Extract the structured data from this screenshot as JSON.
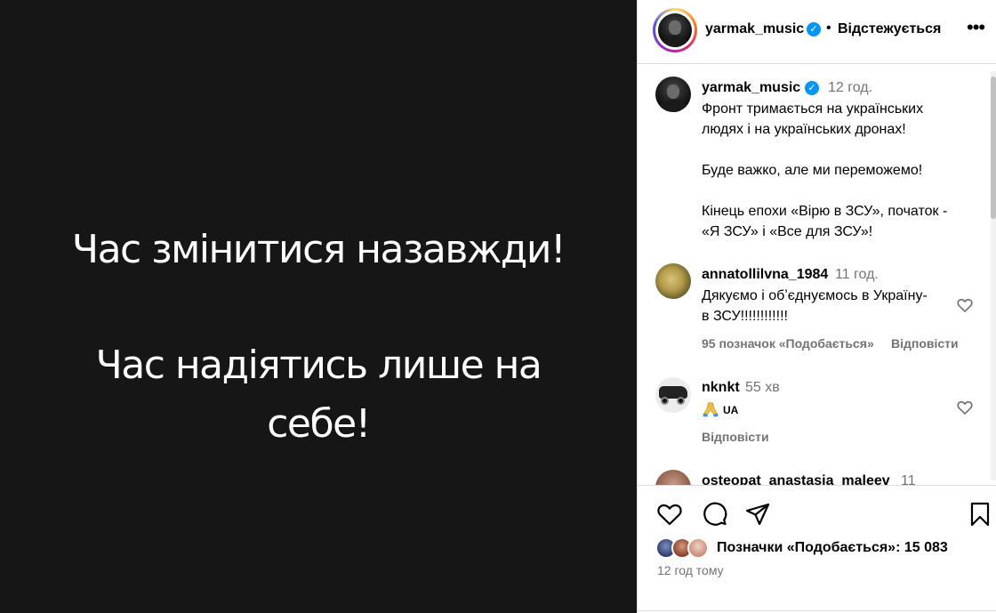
{
  "media": {
    "line1": "Час змінитися назавжди!",
    "line2": "Час надіятись лише на",
    "line3": "себе!",
    "background": "#161616",
    "text_color": "#ffffff"
  },
  "header": {
    "username": "yarmak_music",
    "verified_icon": "verified-badge-icon",
    "separator": "•",
    "follow_status": "Відстежується",
    "more_icon": "more-horizontal-icon"
  },
  "caption": {
    "username": "yarmak_music",
    "time": "12 год.",
    "text": "Фронт тримається на українських\nлюдях і на українських дронах!\n\nБуде важко, але ми переможемо!\n\nКінець епохи «Вірю в ЗСУ», початок -\n«Я ЗСУ» і «Все для ЗСУ»!"
  },
  "comments": [
    {
      "username": "annatollilvna_1984",
      "time": "11 год.",
      "text_line1": "Дякуємо і обʼєднуємось в Україну-",
      "text_line2": "в ЗСУ!!!!!!!!!!!!",
      "likes": "95 позначок «Подобається»",
      "reply": "Відповісти"
    },
    {
      "username": "nknkt",
      "time": "55 хв",
      "emoji": "folded-hands-emoji",
      "text": "UA",
      "reply": "Відповісти"
    },
    {
      "username": "osteopat_anastasia_maleev",
      "time": "11"
    }
  ],
  "actions": {
    "like_icon": "heart-icon",
    "comment_icon": "comment-icon",
    "share_icon": "paper-plane-icon",
    "save_icon": "bookmark-icon",
    "likes_text": "Позначки «Подобається»: 15 083",
    "posted": "12 год тому"
  },
  "colors": {
    "verified": "#0095f6",
    "secondary_text": "#737373",
    "border": "#dbdbdb"
  }
}
